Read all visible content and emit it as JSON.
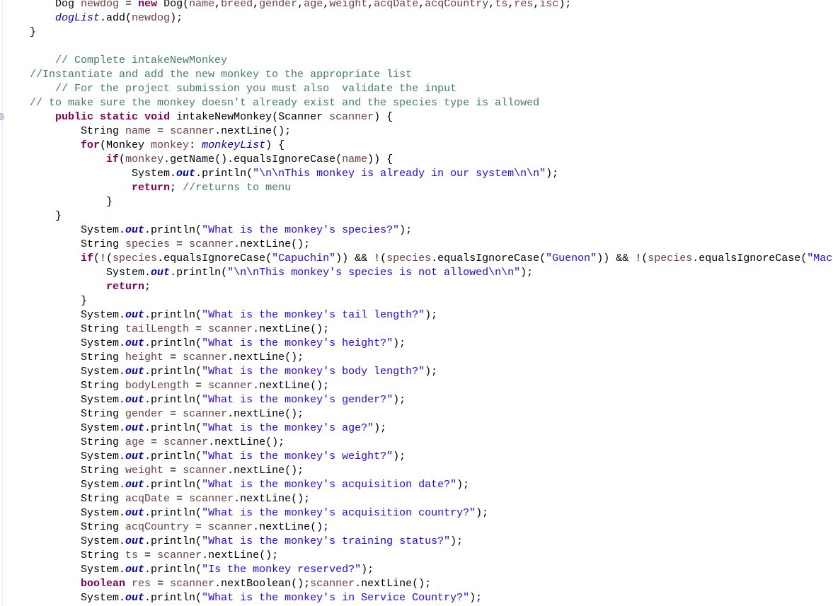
{
  "editor": {
    "language": "java",
    "colors": {
      "keyword": "#7f0055",
      "local_variable": "#6a3e3e",
      "static_field": "#0000c0",
      "string": "#2a00ff",
      "comment": "#3f7f5f",
      "plain": "#000000"
    },
    "gutter_marker": "override-indicator-icon",
    "lines": [
      {
        "indent": 1,
        "tokens": [
          [
            "plain",
            "Dog "
          ],
          [
            "local",
            "newdog"
          ],
          [
            "plain",
            " = "
          ],
          [
            "kw",
            "new"
          ],
          [
            "plain",
            " Dog("
          ],
          [
            "local",
            "name"
          ],
          [
            "plain",
            ","
          ],
          [
            "local",
            "breed"
          ],
          [
            "plain",
            ","
          ],
          [
            "local",
            "gender"
          ],
          [
            "plain",
            ","
          ],
          [
            "local",
            "age"
          ],
          [
            "plain",
            ","
          ],
          [
            "local",
            "weight"
          ],
          [
            "plain",
            ","
          ],
          [
            "local",
            "acqDate"
          ],
          [
            "plain",
            ","
          ],
          [
            "local",
            "acqCountry"
          ],
          [
            "plain",
            ","
          ],
          [
            "local",
            "ts"
          ],
          [
            "plain",
            ","
          ],
          [
            "local",
            "res"
          ],
          [
            "plain",
            ","
          ],
          [
            "local",
            "isc"
          ],
          [
            "plain",
            ");"
          ]
        ]
      },
      {
        "indent": 1,
        "tokens": [
          [
            "field",
            "dogList"
          ],
          [
            "plain",
            ".add("
          ],
          [
            "local",
            "newdog"
          ],
          [
            "plain",
            ");"
          ]
        ]
      },
      {
        "indent": 0,
        "tokens": [
          [
            "plain",
            "}"
          ]
        ]
      },
      {
        "indent": 0,
        "tokens": []
      },
      {
        "indent": 1,
        "tokens": [
          [
            "comment",
            "// Complete intakeNewMonkey"
          ]
        ]
      },
      {
        "indent": 0,
        "tokens": [
          [
            "comment",
            "//Instantiate and add the new monkey to the appropriate list"
          ]
        ]
      },
      {
        "indent": 1,
        "tokens": [
          [
            "comment",
            "// For the project submission you must also  validate the input"
          ]
        ]
      },
      {
        "indent": 0,
        "tokens": [
          [
            "comment",
            "// to make sure the monkey doesn't already exist and the species type is allowed"
          ]
        ]
      },
      {
        "indent": 1,
        "tokens": [
          [
            "kw",
            "public"
          ],
          [
            "plain",
            " "
          ],
          [
            "kw",
            "static"
          ],
          [
            "plain",
            " "
          ],
          [
            "kw",
            "void"
          ],
          [
            "plain",
            " intakeNewMonkey(Scanner "
          ],
          [
            "local",
            "scanner"
          ],
          [
            "plain",
            ") {"
          ]
        ]
      },
      {
        "indent": 2,
        "tokens": [
          [
            "plain",
            "String "
          ],
          [
            "local",
            "name"
          ],
          [
            "plain",
            " = "
          ],
          [
            "local",
            "scanner"
          ],
          [
            "plain",
            ".nextLine();"
          ]
        ]
      },
      {
        "indent": 2,
        "tokens": [
          [
            "kw",
            "for"
          ],
          [
            "plain",
            "(Monkey "
          ],
          [
            "local",
            "monkey"
          ],
          [
            "plain",
            ": "
          ],
          [
            "field",
            "monkeyList"
          ],
          [
            "plain",
            ") {"
          ]
        ]
      },
      {
        "indent": 3,
        "tokens": [
          [
            "kw",
            "if"
          ],
          [
            "plain",
            "("
          ],
          [
            "local",
            "monkey"
          ],
          [
            "plain",
            ".getName().equalsIgnoreCase("
          ],
          [
            "local",
            "name"
          ],
          [
            "plain",
            ")) {"
          ]
        ]
      },
      {
        "indent": 4,
        "tokens": [
          [
            "plain",
            "System."
          ],
          [
            "sfield",
            "out"
          ],
          [
            "plain",
            ".println("
          ],
          [
            "str",
            "\"\\n\\nThis monkey is already in our system\\n\\n\""
          ],
          [
            "plain",
            ");"
          ]
        ]
      },
      {
        "indent": 4,
        "tokens": [
          [
            "kw",
            "return"
          ],
          [
            "plain",
            "; "
          ],
          [
            "comment",
            "//returns to menu"
          ]
        ]
      },
      {
        "indent": 3,
        "tokens": [
          [
            "plain",
            "}"
          ]
        ]
      },
      {
        "indent": 1,
        "tokens": [
          [
            "plain",
            "}"
          ]
        ]
      },
      {
        "indent": 2,
        "tokens": [
          [
            "plain",
            "System."
          ],
          [
            "sfield",
            "out"
          ],
          [
            "plain",
            ".println("
          ],
          [
            "str",
            "\"What is the monkey's species?\""
          ],
          [
            "plain",
            ");"
          ]
        ]
      },
      {
        "indent": 2,
        "tokens": [
          [
            "plain",
            "String "
          ],
          [
            "local",
            "species"
          ],
          [
            "plain",
            " = "
          ],
          [
            "local",
            "scanner"
          ],
          [
            "plain",
            ".nextLine();"
          ]
        ]
      },
      {
        "indent": 2,
        "tokens": [
          [
            "kw",
            "if"
          ],
          [
            "plain",
            "(!("
          ],
          [
            "local",
            "species"
          ],
          [
            "plain",
            ".equalsIgnoreCase("
          ],
          [
            "str",
            "\"Capuchin\""
          ],
          [
            "plain",
            ")) && !("
          ],
          [
            "local",
            "species"
          ],
          [
            "plain",
            ".equalsIgnoreCase("
          ],
          [
            "str",
            "\"Guenon\""
          ],
          [
            "plain",
            ")) && !("
          ],
          [
            "local",
            "species"
          ],
          [
            "plain",
            ".equalsIgnoreCase("
          ],
          [
            "str",
            "\"Maca"
          ]
        ]
      },
      {
        "indent": 3,
        "tokens": [
          [
            "plain",
            "System."
          ],
          [
            "sfield",
            "out"
          ],
          [
            "plain",
            ".println("
          ],
          [
            "str",
            "\"\\n\\nThis monkey's species is not allowed\\n\\n\""
          ],
          [
            "plain",
            ");"
          ]
        ]
      },
      {
        "indent": 3,
        "tokens": [
          [
            "kw",
            "return"
          ],
          [
            "plain",
            ";"
          ]
        ]
      },
      {
        "indent": 2,
        "tokens": [
          [
            "plain",
            "}"
          ]
        ]
      },
      {
        "indent": 2,
        "tokens": [
          [
            "plain",
            "System."
          ],
          [
            "sfield",
            "out"
          ],
          [
            "plain",
            ".println("
          ],
          [
            "str",
            "\"What is the monkey's tail length?\""
          ],
          [
            "plain",
            ");"
          ]
        ]
      },
      {
        "indent": 2,
        "tokens": [
          [
            "plain",
            "String "
          ],
          [
            "local",
            "tailLength"
          ],
          [
            "plain",
            " = "
          ],
          [
            "local",
            "scanner"
          ],
          [
            "plain",
            ".nextLine();"
          ]
        ]
      },
      {
        "indent": 2,
        "tokens": [
          [
            "plain",
            "System."
          ],
          [
            "sfield",
            "out"
          ],
          [
            "plain",
            ".println("
          ],
          [
            "str",
            "\"What is the monkey's height?\""
          ],
          [
            "plain",
            ");"
          ]
        ]
      },
      {
        "indent": 2,
        "tokens": [
          [
            "plain",
            "String "
          ],
          [
            "local",
            "height"
          ],
          [
            "plain",
            " = "
          ],
          [
            "local",
            "scanner"
          ],
          [
            "plain",
            ".nextLine();"
          ]
        ]
      },
      {
        "indent": 2,
        "tokens": [
          [
            "plain",
            "System."
          ],
          [
            "sfield",
            "out"
          ],
          [
            "plain",
            ".println("
          ],
          [
            "str",
            "\"What is the monkey's body length?\""
          ],
          [
            "plain",
            ");"
          ]
        ]
      },
      {
        "indent": 2,
        "tokens": [
          [
            "plain",
            "String "
          ],
          [
            "local",
            "bodyLength"
          ],
          [
            "plain",
            " = "
          ],
          [
            "local",
            "scanner"
          ],
          [
            "plain",
            ".nextLine();"
          ]
        ]
      },
      {
        "indent": 2,
        "tokens": [
          [
            "plain",
            "System."
          ],
          [
            "sfield",
            "out"
          ],
          [
            "plain",
            ".println("
          ],
          [
            "str",
            "\"What is the monkey's gender?\""
          ],
          [
            "plain",
            ");"
          ]
        ]
      },
      {
        "indent": 2,
        "tokens": [
          [
            "plain",
            "String "
          ],
          [
            "local",
            "gender"
          ],
          [
            "plain",
            " = "
          ],
          [
            "local",
            "scanner"
          ],
          [
            "plain",
            ".nextLine();"
          ]
        ]
      },
      {
        "indent": 2,
        "tokens": [
          [
            "plain",
            "System."
          ],
          [
            "sfield",
            "out"
          ],
          [
            "plain",
            ".println("
          ],
          [
            "str",
            "\"What is the monkey's age?\""
          ],
          [
            "plain",
            ");"
          ]
        ]
      },
      {
        "indent": 2,
        "tokens": [
          [
            "plain",
            "String "
          ],
          [
            "local",
            "age"
          ],
          [
            "plain",
            " = "
          ],
          [
            "local",
            "scanner"
          ],
          [
            "plain",
            ".nextLine();"
          ]
        ]
      },
      {
        "indent": 2,
        "tokens": [
          [
            "plain",
            "System."
          ],
          [
            "sfield",
            "out"
          ],
          [
            "plain",
            ".println("
          ],
          [
            "str",
            "\"What is the monkey's weight?\""
          ],
          [
            "plain",
            ");"
          ]
        ]
      },
      {
        "indent": 2,
        "tokens": [
          [
            "plain",
            "String "
          ],
          [
            "local",
            "weight"
          ],
          [
            "plain",
            " = "
          ],
          [
            "local",
            "scanner"
          ],
          [
            "plain",
            ".nextLine();"
          ]
        ]
      },
      {
        "indent": 2,
        "tokens": [
          [
            "plain",
            "System."
          ],
          [
            "sfield",
            "out"
          ],
          [
            "plain",
            ".println("
          ],
          [
            "str",
            "\"What is the monkey's acquisition date?\""
          ],
          [
            "plain",
            ");"
          ]
        ]
      },
      {
        "indent": 2,
        "tokens": [
          [
            "plain",
            "String "
          ],
          [
            "local",
            "acqDate"
          ],
          [
            "plain",
            " = "
          ],
          [
            "local",
            "scanner"
          ],
          [
            "plain",
            ".nextLine();"
          ]
        ]
      },
      {
        "indent": 2,
        "tokens": [
          [
            "plain",
            "System."
          ],
          [
            "sfield",
            "out"
          ],
          [
            "plain",
            ".println("
          ],
          [
            "str",
            "\"What is the monkey's acquisition country?\""
          ],
          [
            "plain",
            ");"
          ]
        ]
      },
      {
        "indent": 2,
        "tokens": [
          [
            "plain",
            "String "
          ],
          [
            "local",
            "acqCountry"
          ],
          [
            "plain",
            " = "
          ],
          [
            "local",
            "scanner"
          ],
          [
            "plain",
            ".nextLine();"
          ]
        ]
      },
      {
        "indent": 2,
        "tokens": [
          [
            "plain",
            "System."
          ],
          [
            "sfield",
            "out"
          ],
          [
            "plain",
            ".println("
          ],
          [
            "str",
            "\"What is the monkey's training status?\""
          ],
          [
            "plain",
            ");"
          ]
        ]
      },
      {
        "indent": 2,
        "tokens": [
          [
            "plain",
            "String "
          ],
          [
            "local",
            "ts"
          ],
          [
            "plain",
            " = "
          ],
          [
            "local",
            "scanner"
          ],
          [
            "plain",
            ".nextLine();"
          ]
        ]
      },
      {
        "indent": 2,
        "tokens": [
          [
            "plain",
            "System."
          ],
          [
            "sfield",
            "out"
          ],
          [
            "plain",
            ".println("
          ],
          [
            "str",
            "\"Is the monkey reserved?\""
          ],
          [
            "plain",
            ");"
          ]
        ]
      },
      {
        "indent": 2,
        "tokens": [
          [
            "kw",
            "boolean"
          ],
          [
            "plain",
            " "
          ],
          [
            "local",
            "res"
          ],
          [
            "plain",
            " = "
          ],
          [
            "local",
            "scanner"
          ],
          [
            "plain",
            ".nextBoolean();"
          ],
          [
            "local",
            "scanner"
          ],
          [
            "plain",
            ".nextLine();"
          ]
        ]
      },
      {
        "indent": 2,
        "tokens": [
          [
            "plain",
            "System."
          ],
          [
            "sfield",
            "out"
          ],
          [
            "plain",
            ".println("
          ],
          [
            "str",
            "\"What is the monkey's in Service Country?\""
          ],
          [
            "plain",
            ");"
          ]
        ]
      }
    ]
  }
}
